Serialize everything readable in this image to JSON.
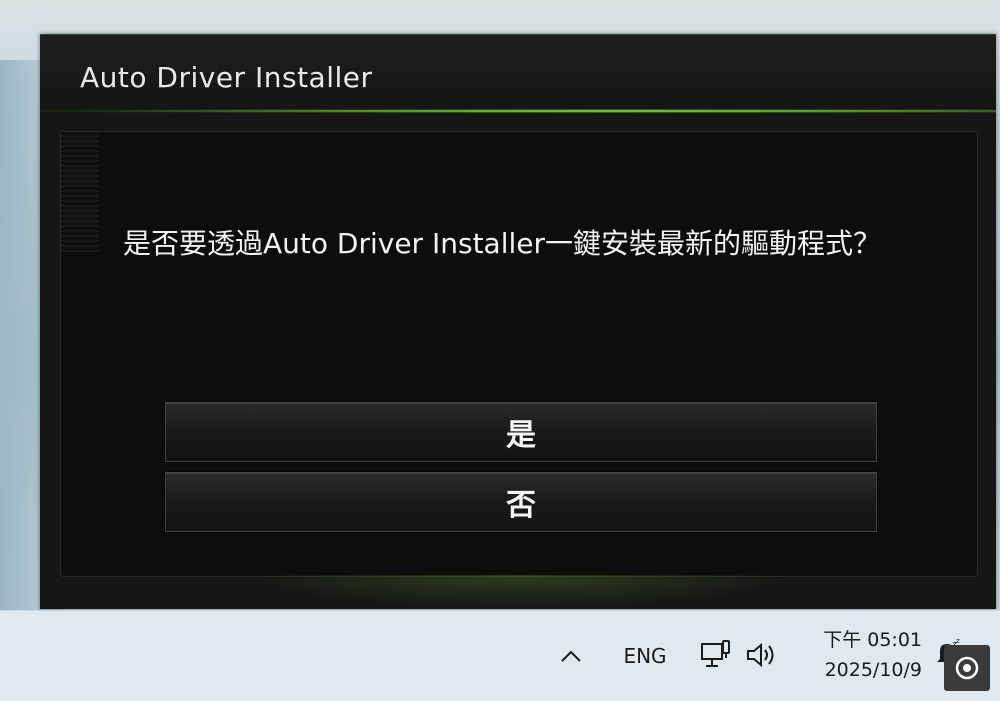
{
  "window": {
    "title": "Auto Driver Installer",
    "message": "是否要透過Auto Driver Installer一鍵安裝最新的驅動程式？",
    "buttons": {
      "yes": "是",
      "no": "否"
    },
    "accent_color": "#8fe23c"
  },
  "taskbar": {
    "tray_overflow_icon": "chevron-up-icon",
    "language": "ENG",
    "network_icon": "network-icon",
    "volume_icon": "volume-icon",
    "time": "下午 05:01",
    "date": "2025/10/9",
    "notification_icon": "notification-bell-icon",
    "corner_icon": "focus-target-icon"
  }
}
